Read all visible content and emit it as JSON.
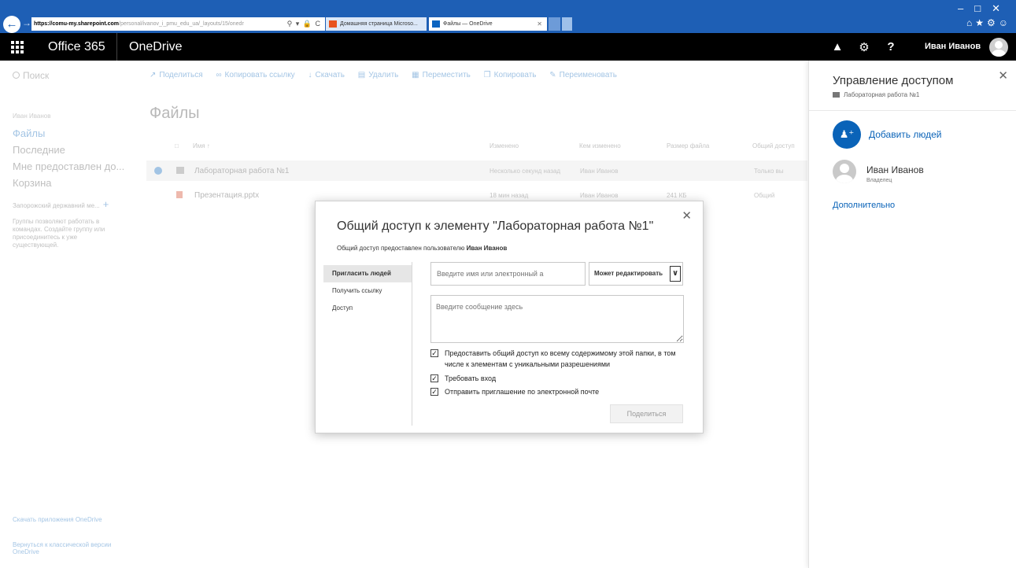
{
  "browser": {
    "url_host": "https://comu-my.sharepoint.com",
    "url_path": "/personal/ivanov_i_pmu_edu_ua/_layouts/15/onedr",
    "tabs": [
      {
        "label": "Домашняя страница Microso..."
      },
      {
        "label": "Файлы — OneDrive"
      }
    ]
  },
  "suite_bar": {
    "brand": "Office 365",
    "app": "OneDrive",
    "user_name": "Иван Иванов"
  },
  "search": {
    "label": "Поиск"
  },
  "command_bar": [
    {
      "label": "Поделиться",
      "icon": "share-icon"
    },
    {
      "label": "Копировать ссылку",
      "icon": "link-icon"
    },
    {
      "label": "Скачать",
      "icon": "download-icon"
    },
    {
      "label": "Удалить",
      "icon": "delete-icon"
    },
    {
      "label": "Переместить",
      "icon": "move-icon"
    },
    {
      "label": "Копировать",
      "icon": "copy-icon"
    },
    {
      "label": "Переименовать",
      "icon": "rename-icon"
    }
  ],
  "left_nav": {
    "owner": "Иван Иванов",
    "items": [
      {
        "label": "Файлы"
      },
      {
        "label": "Последние"
      },
      {
        "label": "Мне предоставлен до..."
      },
      {
        "label": "Корзина"
      }
    ],
    "groups_label": "Запорожский державний ме...",
    "groups_add": "+",
    "groups_desc": "Группы позволяют работать в командах. Создайте группу или присоединитесь к уже существующей.",
    "footer_download": "Скачать приложения OneDrive",
    "footer_classic": "Вернуться к классической версии OneDrive"
  },
  "page": {
    "title": "Файлы"
  },
  "columns": {
    "name": "Имя ↑",
    "modified": "Изменено",
    "modified_by": "Кем изменено",
    "size": "Размер файла",
    "sharing": "Общий доступ"
  },
  "files": [
    {
      "name": "Лабораторная работа №1",
      "modified": "Несколько секунд назад",
      "modified_by": "Иван Иванов",
      "size": "",
      "sharing": "Только вы",
      "type": "folder"
    },
    {
      "name": "Презентация.pptx",
      "modified": "18 мин назад",
      "modified_by": "Иван Иванов",
      "size": "241 КБ",
      "sharing": "Общий",
      "type": "pptx"
    }
  ],
  "access_panel": {
    "title": "Управление доступом",
    "item": "Лабораторная работа №1",
    "add_people": "Добавить людей",
    "user_name": "Иван Иванов",
    "user_role": "Владелец",
    "more": "Дополнительно"
  },
  "dialog": {
    "title": "Общий доступ к элементу \"Лабораторная работа №1\"",
    "shared_with_prefix": "Общий доступ предоставлен пользователю",
    "shared_with_user": "Иван Иванов",
    "nav": [
      {
        "label": "Пригласить людей"
      },
      {
        "label": "Получить ссылку"
      },
      {
        "label": "Доступ"
      }
    ],
    "name_placeholder": "Введите имя или электронный а",
    "permission": "Может редактировать",
    "message_placeholder": "Введите сообщение здесь",
    "checkboxes": [
      {
        "label": "Предоставить общий доступ ко всему содержимому этой папки, в том числе к элементам с уникальными разрешениями",
        "checked": true
      },
      {
        "label": "Требовать вход",
        "checked": true
      },
      {
        "label": "Отправить приглашение по электронной почте",
        "checked": true
      }
    ],
    "share_button": "Поделиться"
  },
  "colors": {
    "browser_chrome": "#1e5fb5",
    "suite_bar": "#000000",
    "accent": "#0a63b8"
  }
}
